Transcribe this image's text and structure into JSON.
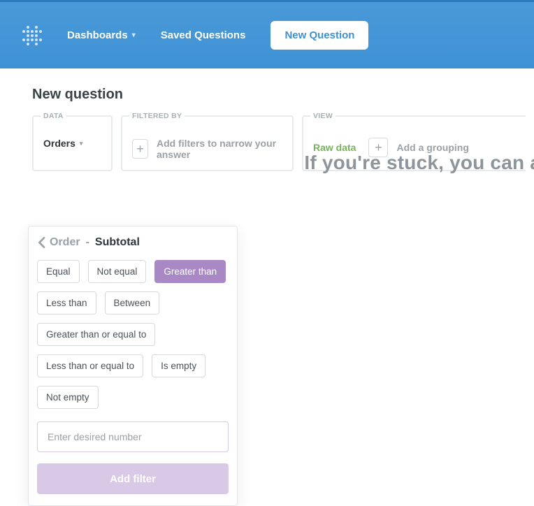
{
  "nav": {
    "dashboards": "Dashboards",
    "saved_questions": "Saved Questions",
    "new_question": "New Question"
  },
  "page": {
    "title": "New question",
    "stuck_teaser": "If you're stuck, you can alw"
  },
  "builder": {
    "data_label": "DATA",
    "data_value": "Orders",
    "filter_label": "FILTERED BY",
    "filter_placeholder": "Add filters to narrow your answer",
    "view_label": "VIEW",
    "view_value": "Raw data",
    "group_placeholder": "Add a grouping"
  },
  "filter_popover": {
    "back_label": "Order",
    "dash": "-",
    "column": "Subtotal",
    "operators": {
      "equal": "Equal",
      "not_equal": "Not equal",
      "greater_than": "Greater than",
      "less_than": "Less than",
      "between": "Between",
      "gte": "Greater than or equal to",
      "lte": "Less than or equal to",
      "is_empty": "Is empty",
      "not_empty": "Not empty"
    },
    "selected_operator": "greater_than",
    "input_placeholder": "Enter desired number",
    "add_filter": "Add filter"
  }
}
